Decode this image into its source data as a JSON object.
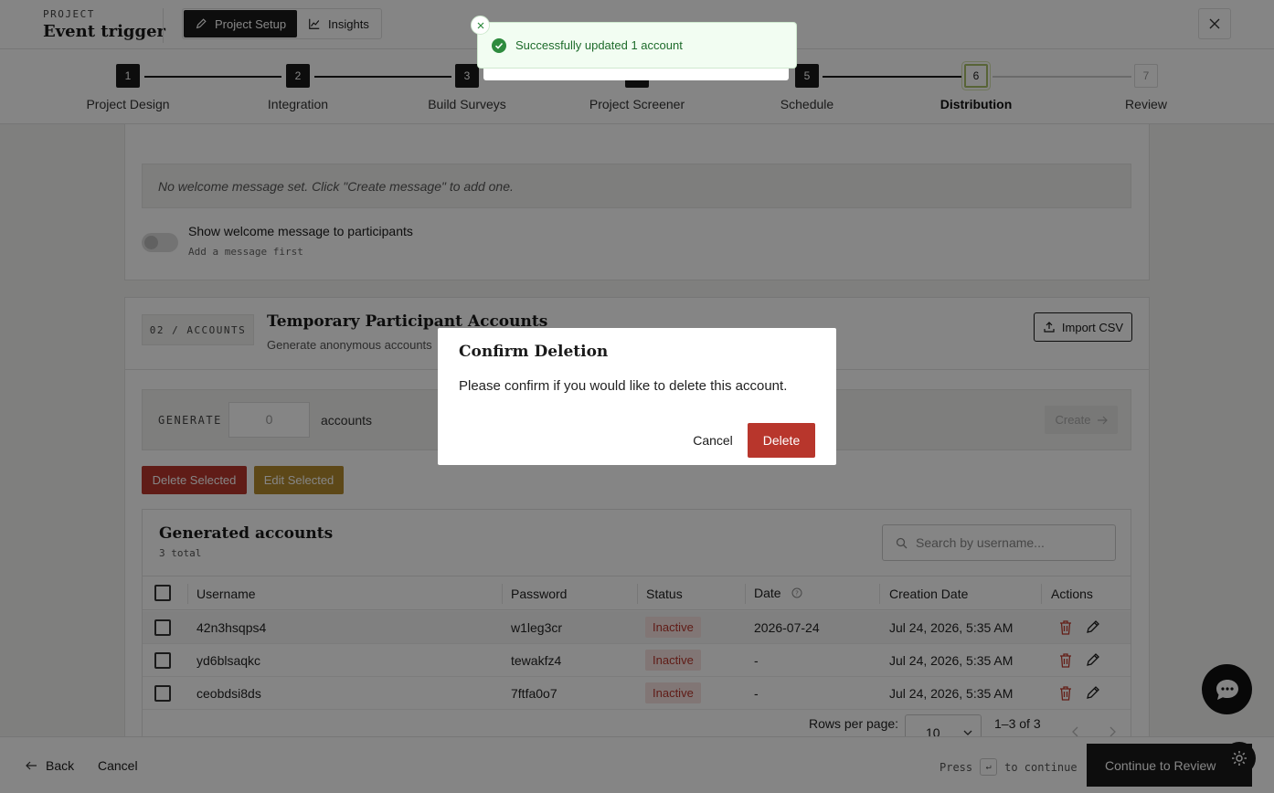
{
  "header": {
    "caption": "PROJECT",
    "title": "Event trigger",
    "tabs": [
      {
        "label": "Project Setup",
        "icon": "pencil-icon",
        "active": true
      },
      {
        "label": "Insights",
        "icon": "chart-line-icon",
        "active": false
      }
    ]
  },
  "stepper": {
    "steps": [
      {
        "num": "1",
        "label": "Project Design"
      },
      {
        "num": "2",
        "label": "Integration"
      },
      {
        "num": "3",
        "label": "Build Surveys"
      },
      {
        "num": "4",
        "label": "Project Screener"
      },
      {
        "num": "5",
        "label": "Schedule"
      },
      {
        "num": "6",
        "label": "Distribution"
      },
      {
        "num": "7",
        "label": "Review"
      }
    ],
    "current": "6"
  },
  "welcome": {
    "empty_text": "No welcome message set. Click \"Create message\" to add one.",
    "toggle_title": "Show welcome message to participants",
    "toggle_sub": "Add a message first"
  },
  "accounts_section": {
    "badge": "02 / ACCOUNTS",
    "title": "Temporary Participant Accounts",
    "subtitle": "Generate anonymous accounts",
    "import_label": "Import CSV",
    "generate_label": "GENERATE",
    "generate_value": "0",
    "generate_unit": "accounts",
    "create_label": "Create",
    "delete_selected": "Delete Selected",
    "edit_selected": "Edit Selected"
  },
  "table": {
    "title": "Generated accounts",
    "total": "3 total",
    "search_placeholder": "Search by username...",
    "columns": [
      "Username",
      "Password",
      "Status",
      "Date",
      "Creation Date",
      "Actions"
    ],
    "rows": [
      {
        "username": "42n3hsqps4",
        "password": "w1leg3cr",
        "status": "Inactive",
        "date": "2026-07-24",
        "created": "Jul 24, 2026, 5:35 AM"
      },
      {
        "username": "yd6blsaqkc",
        "password": "tewakfz4",
        "status": "Inactive",
        "date": "-",
        "created": "Jul 24, 2026, 5:35 AM"
      },
      {
        "username": "ceobdsi8ds",
        "password": "7ftfa0o7",
        "status": "Inactive",
        "date": "-",
        "created": "Jul 24, 2026, 5:35 AM"
      }
    ],
    "rows_per_page_label": "Rows per page:",
    "rows_per_page": "10",
    "range": "1–3 of 3"
  },
  "footer": {
    "back": "Back",
    "cancel": "Cancel",
    "hint_pre": "Press",
    "hint_key": "↵",
    "hint_post": "to continue",
    "continue": "Continue to Review"
  },
  "dialog": {
    "title": "Confirm Deletion",
    "message": "Please confirm if you would like to delete this account.",
    "cancel": "Cancel",
    "delete": "Delete"
  },
  "toast": {
    "message": "Successfully updated 1 account"
  },
  "colors": {
    "danger": "#b8362c",
    "warning": "#b38a2e",
    "success": "#1d6b2a",
    "dark": "#1a1a1a"
  }
}
